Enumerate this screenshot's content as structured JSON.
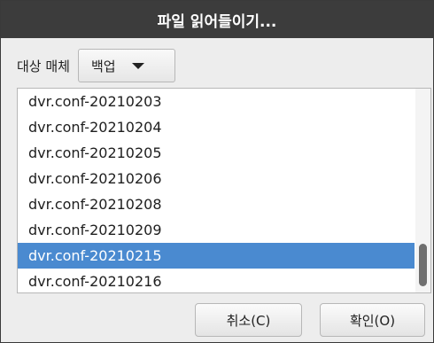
{
  "dialog": {
    "title": "파일 읽어들이기..."
  },
  "media": {
    "label": "대상 매체",
    "selected": "백업",
    "arrow_icon": "chevron-down-icon"
  },
  "files": [
    "dvr.conf-20210203",
    "dvr.conf-20210204",
    "dvr.conf-20210205",
    "dvr.conf-20210206",
    "dvr.conf-20210208",
    "dvr.conf-20210209",
    "dvr.conf-20210215",
    "dvr.conf-20210216"
  ],
  "selected_file": "dvr.conf-20210215",
  "buttons": {
    "cancel": "취소(C)",
    "ok": "확인(O)"
  },
  "colors": {
    "titlebar": "#3c3c3c",
    "selection": "#4a8ad0"
  }
}
